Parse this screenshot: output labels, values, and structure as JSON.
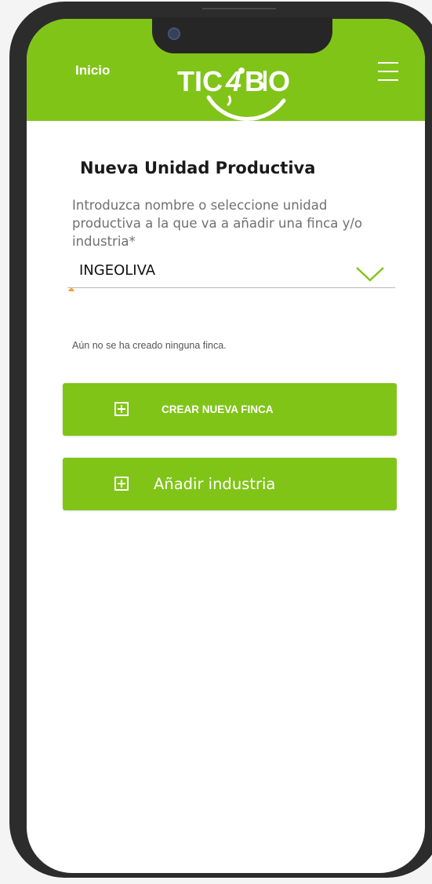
{
  "header": {
    "home_label": "Inicio",
    "logo_text": "TIC4BIO",
    "background_color": "#80c418",
    "menu_icon": "hamburger-icon"
  },
  "form": {
    "title": "Nueva Unidad Productiva",
    "field_label": "Introduzca nombre o seleccione unidad productiva a la que va a añadir una finca y/o industria*",
    "selected_value": "INGEOLIVA",
    "dropdown_icon": "chevron-down-icon"
  },
  "fincas": {
    "empty_message": "Aún no se ha creado ninguna finca."
  },
  "actions": {
    "create_finca_label": "CREAR NUEVA FINCA",
    "add_industry_label": "Añadir industria",
    "button_icon": "plus-square-icon",
    "button_color": "#80c418"
  }
}
